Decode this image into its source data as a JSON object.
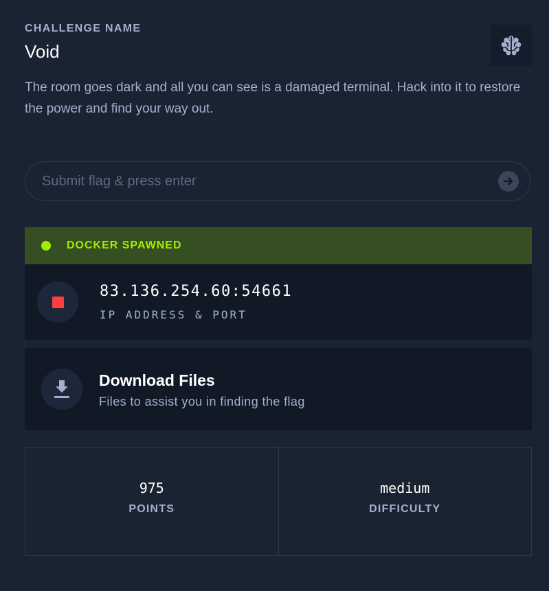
{
  "challenge": {
    "heading": "CHALLENGE NAME",
    "name": "Void",
    "category_icon": "brain-icon",
    "description": "The room goes dark and all you can see is a damaged terminal. Hack into it to restore the power and find your way out."
  },
  "flag_form": {
    "placeholder": "Submit flag & press enter",
    "value": "",
    "submit_icon": "arrow-right-icon"
  },
  "docker": {
    "status": "DOCKER SPAWNED",
    "status_color": "#9fef00",
    "stop_icon": "stop-icon",
    "stop_color": "#ff3e3e",
    "address": "83.136.254.60:54661",
    "address_label": "IP ADDRESS & PORT"
  },
  "download": {
    "icon": "download-icon",
    "title": "Download Files",
    "subtitle": "Files to assist you in finding the flag"
  },
  "stats": {
    "points": "975",
    "points_label": "POINTS",
    "difficulty": "medium",
    "difficulty_label": "DIFFICULTY"
  },
  "colors": {
    "background": "#1a2332",
    "card": "#111927",
    "accent_green": "#9fef00",
    "muted_text": "#a4b1cd"
  }
}
